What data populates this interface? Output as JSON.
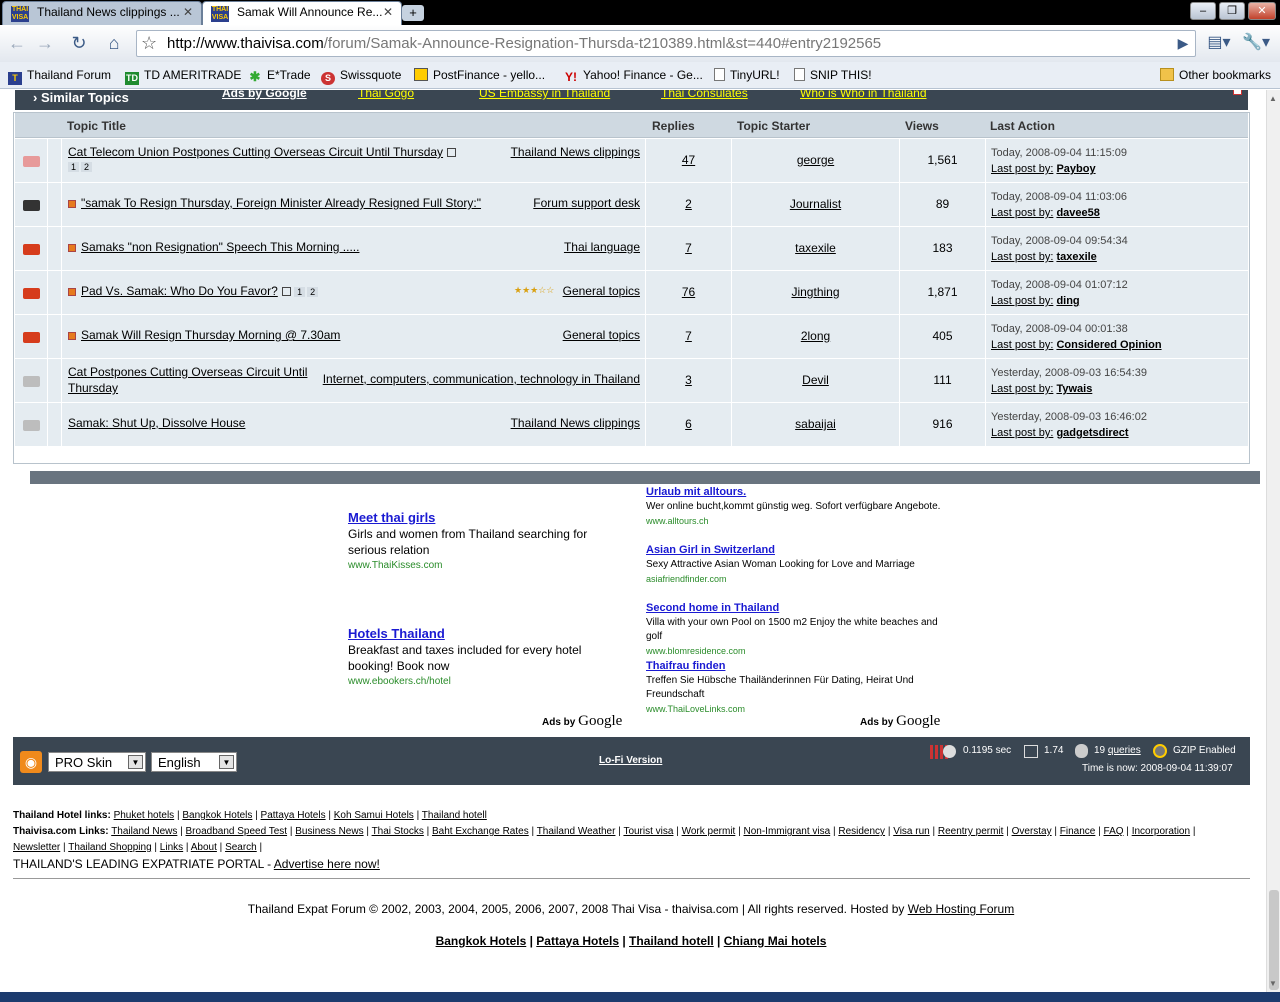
{
  "browser": {
    "tabs": [
      {
        "title": "Thailand News clippings ...",
        "active": false
      },
      {
        "title": "Samak Will Announce Re...",
        "active": true
      }
    ],
    "url_host": "http://www.thaivisa.com",
    "url_path": "/forum/Samak-Announce-Resignation-Thursda-t210389.html&st=440#entry2192565",
    "bookmarks": [
      "Thailand Forum",
      "TD AMERITRADE",
      "E*Trade",
      "Swissquote",
      "PostFinance - yello...",
      "Yahoo! Finance - Ge...",
      "TinyURL!",
      "SNIP THIS!"
    ],
    "other_bookmarks": "Other bookmarks"
  },
  "similar": {
    "title": "Similar Topics",
    "ad_links": [
      "Ads by Google",
      "Thai Gogo",
      "US Embassy in Thailand",
      "Thai Consulates",
      "Who is Who in Thailand"
    ],
    "headers": [
      "Topic Title",
      "Replies",
      "Topic Starter",
      "Views",
      "Last Action"
    ],
    "rows": [
      {
        "title": "Cat Telecom Union Postpones Cutting Overseas Circuit Until Thursday",
        "forum": "Thailand News clippings",
        "replies": "47",
        "starter": "george",
        "views": "1,561",
        "date": "Today, 2008-09-04 11:15:09",
        "last_label": "Last post by:",
        "last_by": "Payboy",
        "pages": [
          "1",
          "2"
        ],
        "folder": "#e79a9a"
      },
      {
        "title": "\"samak To Resign Thursday, Foreign Minister Already Resigned Full Story:\"",
        "forum": "Forum support desk",
        "replies": "2",
        "starter": "Journalist",
        "views": "89",
        "date": "Today, 2008-09-04 11:03:06",
        "last_label": "Last post by:",
        "last_by": "davee58",
        "pages": [],
        "folder": "#333"
      },
      {
        "title": "Samaks \"non Resignation\" Speech This Morning .....",
        "forum": "Thai language",
        "replies": "7",
        "starter": "taxexile",
        "views": "183",
        "date": "Today, 2008-09-04 09:54:34",
        "last_label": "Last post by:",
        "last_by": "taxexile",
        "pages": [],
        "folder": "#d63c1c"
      },
      {
        "title": "Pad Vs. Samak: Who Do You Favor?",
        "forum": "General topics",
        "replies": "76",
        "starter": "Jingthing",
        "views": "1,871",
        "date": "Today, 2008-09-04 01:07:12",
        "last_label": "Last post by:",
        "last_by": "ding",
        "pages": [
          "1",
          "2"
        ],
        "folder": "#d63c1c"
      },
      {
        "title": "Samak Will Resign Thursday Morning @ 7.30am",
        "forum": "General topics",
        "replies": "7",
        "starter": "2long",
        "views": "405",
        "date": "Today, 2008-09-04 00:01:38",
        "last_label": "Last post by:",
        "last_by": "Considered Opinion",
        "pages": [],
        "folder": "#d63c1c"
      },
      {
        "title": "Cat Postpones Cutting Overseas Circuit Until Thursday",
        "forum": "Internet, computers, communication, technology in Thailand",
        "replies": "3",
        "starter": "Devil",
        "views": "111",
        "date": "Yesterday, 2008-09-03 16:54:39",
        "last_label": "Last post by:",
        "last_by": "Tywais",
        "pages": [],
        "folder": "#bdbdbd"
      },
      {
        "title": "Samak: Shut Up, Dissolve House",
        "forum": "Thailand News clippings",
        "replies": "6",
        "starter": "sabaijai",
        "views": "916",
        "date": "Yesterday, 2008-09-03 16:46:02",
        "last_label": "Last post by:",
        "last_by": "gadgetsdirect",
        "pages": [],
        "folder": "#bdbdbd"
      }
    ]
  },
  "ads_left": [
    {
      "title": "Meet thai girls",
      "text": "Girls and women from Thailand searching for serious relation",
      "url": "www.ThaiKisses.com"
    },
    {
      "title": "Hotels Thailand",
      "text": "Breakfast and taxes included for every hotel booking! Book now",
      "url": "www.ebookers.ch/hotel"
    }
  ],
  "ads_right": [
    {
      "title": "Urlaub mit alltours.",
      "text": "Wer online bucht,kommt günstig weg. Sofort verfügbare Angebote.",
      "url": "www.alltours.ch"
    },
    {
      "title": "Asian Girl in Switzerland",
      "text": "Sexy Attractive Asian Woman Looking for Love and Marriage",
      "url": "asiafriendfinder.com"
    },
    {
      "title": "Second home in Thailand",
      "text": "Villa with your own Pool on 1500 m2 Enjoy the white beaches and golf",
      "url": "www.blomresidence.com"
    },
    {
      "title": "Thaifrau finden",
      "text": "Treffen Sie Hübsche Thailänderinnen Für Dating, Heirat Und Freundschaft",
      "url": "www.ThaiLoveLinks.com"
    }
  ],
  "ads_by": "Ads by",
  "google": "Google",
  "footer": {
    "skin": "PRO Skin",
    "lang": "English",
    "lofi": "Lo-Fi Version",
    "time_sec": "0.1195 sec",
    "load": "1.74",
    "queries_n": "19",
    "queries": "queries",
    "gzip": "GZIP Enabled",
    "time_now": "Time is now: 2008-09-04 11:39:07"
  },
  "hotel_label": "Thailand Hotel links:",
  "hotel_links": [
    "Phuket hotels",
    "Bangkok Hotels",
    "Pattaya Hotels",
    "Koh Samui Hotels",
    "Thailand hotell"
  ],
  "tv_label": "Thaivisa.com Links:",
  "tv_links": [
    "Thailand News",
    "Broadband Speed Test",
    "Business News",
    "Thai Stocks",
    "Baht Exchange Rates",
    "Thailand Weather",
    "Tourist visa",
    "Work permit",
    "Non-Immigrant visa",
    "Residency",
    "Visa run",
    "Reentry permit",
    "Overstay",
    "Finance",
    "FAQ",
    "Incorporation",
    "Newsletter",
    "Thailand Shopping",
    "Links",
    "About",
    "Search"
  ],
  "leading": "THAILAND'S LEADING EXPATRIATE PORTAL - ",
  "advertise": "Advertise here now!",
  "copyright": "Thailand Expat Forum © 2002, 2003, 2004, 2005, 2006, 2007, 2008 Thai Visa - thaivisa.com | All rights reserved. Hosted by ",
  "hosted": "Web Hosting Forum",
  "bottom_links": [
    "Bangkok Hotels",
    "Pattaya Hotels",
    "Thailand hotell",
    "Chiang Mai hotels"
  ]
}
